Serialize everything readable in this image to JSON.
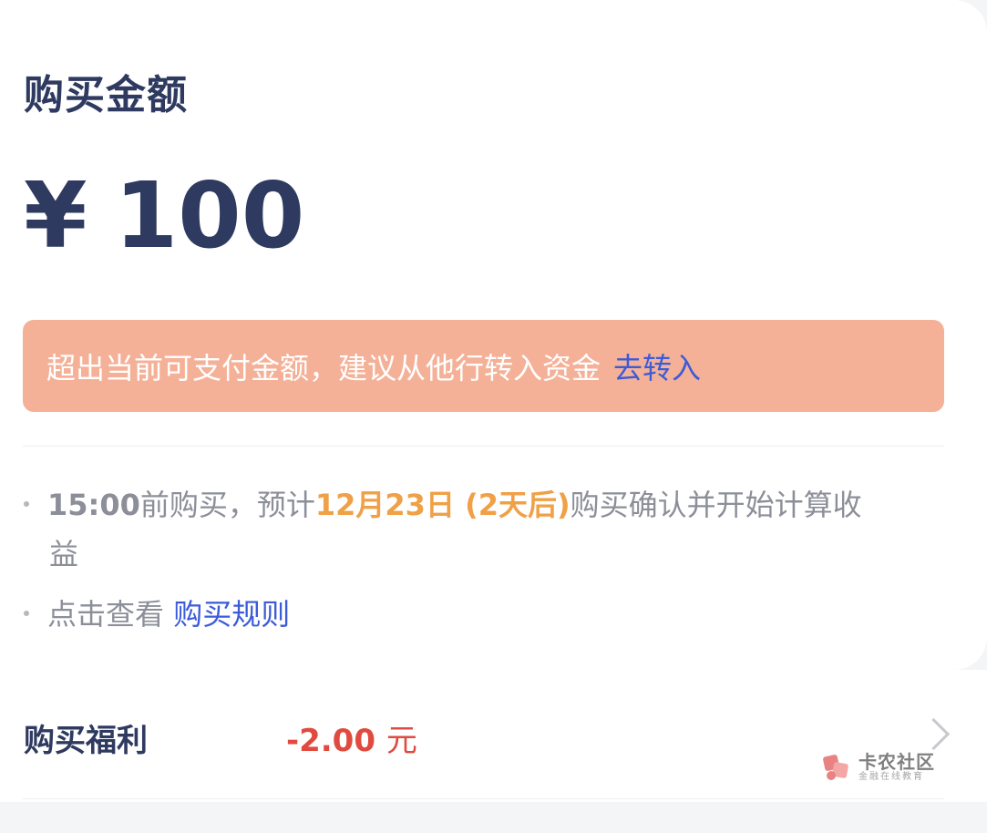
{
  "purchase": {
    "title": "购买金额",
    "currency_symbol": "¥",
    "amount": "100"
  },
  "warning": {
    "text": "超出当前可支付金额，建议从他行转入资金",
    "action_label": "去转入",
    "background_color": "#f4b197",
    "link_color": "#3b5bd9"
  },
  "notes": {
    "line1": {
      "time": "15:00",
      "text_a": "前购买，预计",
      "date_highlight": "12月23日 (2天后)",
      "text_b": "购买确认并开始计算收",
      "text_c": "益"
    },
    "line2": {
      "prefix": "点击查看",
      "link_label": "购买规则"
    }
  },
  "benefit": {
    "label": "购买福利",
    "value": "-2.00",
    "unit": "元",
    "value_color": "#e04a3f"
  },
  "watermark": {
    "title": "卡农社区",
    "subtitle": "金融在线教育",
    "icon": "kanong-logo-icon"
  },
  "colors": {
    "primary_text": "#2e3a60",
    "highlight_orange": "#f0a046"
  }
}
